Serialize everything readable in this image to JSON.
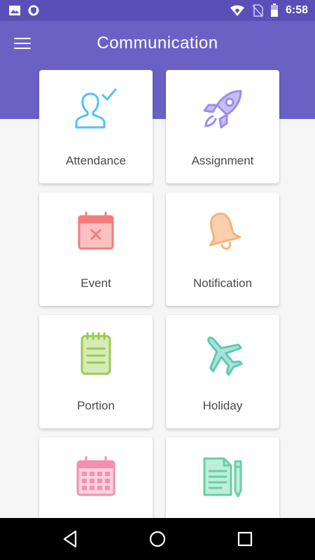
{
  "status_bar": {
    "time": "6:58",
    "icons": [
      "image-icon",
      "shield-icon",
      "wifi-icon",
      "no-sim-icon",
      "battery-icon"
    ]
  },
  "app_bar": {
    "title": "Communication",
    "menu_icon": "menu-icon",
    "color": "#6b61c4"
  },
  "cards": [
    {
      "label": "Attendance",
      "icon": "person-check-icon",
      "color": "#4fc3f7"
    },
    {
      "label": "Assignment",
      "icon": "rocket-icon",
      "color": "#9b8cf0"
    },
    {
      "label": "Event",
      "icon": "calendar-x-icon",
      "color": "#f47b7b"
    },
    {
      "label": "Notification",
      "icon": "bell-icon",
      "color": "#f8b27a"
    },
    {
      "label": "Portion",
      "icon": "notepad-icon",
      "color": "#9cc95a"
    },
    {
      "label": "Holiday",
      "icon": "airplane-icon",
      "color": "#5ec9b5"
    },
    {
      "label": "",
      "icon": "calendar-grid-icon",
      "color": "#f48fb1"
    },
    {
      "label": "",
      "icon": "document-pen-icon",
      "color": "#66d0a6"
    }
  ],
  "nav_bar": {
    "icons": [
      "back-icon",
      "home-icon",
      "recents-icon"
    ]
  }
}
